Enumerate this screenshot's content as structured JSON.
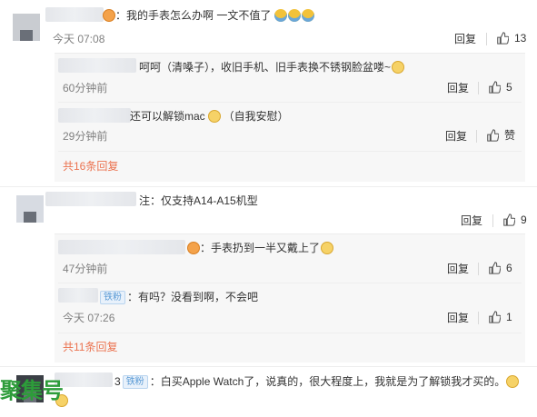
{
  "comment1": {
    "text": "：我的手表怎么办啊 一文不值了",
    "time": "今天 07:08",
    "reply_label": "回复",
    "like_count": "13",
    "replies": [
      {
        "text": "呵呵（清嗓子），收旧手机、旧手表换不锈钢脸盆喽~",
        "time": "60分钟前",
        "reply_label": "回复",
        "like_count": "5"
      },
      {
        "text": "还可以解锁mac",
        "text_after": "（自我安慰）",
        "time": "29分钟前",
        "reply_label": "回复",
        "like_label": "赞"
      }
    ],
    "more_replies": "共16条回复"
  },
  "comment2": {
    "text": "注：仅支持A14-A15机型",
    "reply_label": "回复",
    "like_count": "9",
    "replies": [
      {
        "text": "：手表扔到一半又戴上了",
        "time": "47分钟前",
        "reply_label": "回复",
        "like_count": "6"
      },
      {
        "badge": "铁粉",
        "text": "：有吗？没看到啊，不会吧",
        "time": "今天 07:26",
        "reply_label": "回复",
        "like_count": "1"
      }
    ],
    "more_replies": "共11条回复"
  },
  "comment3": {
    "name_suffix": "3",
    "badge": "铁粉",
    "text": "：白买Apple Watch了，说真的，很大程度上，我就是为了解锁我才买的。"
  },
  "watermark": "聚集号",
  "colors": {
    "link": "#eb7350",
    "meta": "#808080",
    "badge": "#5b9bd5",
    "watermark": "#2d9c3a"
  },
  "icons": {
    "like": "thumb-up-icon",
    "emoji_sweat": "sweat-smile-emoji-icon",
    "emoji_dog": "doge-emoji-icon",
    "emoji_laugh": "laugh-emoji-icon"
  }
}
